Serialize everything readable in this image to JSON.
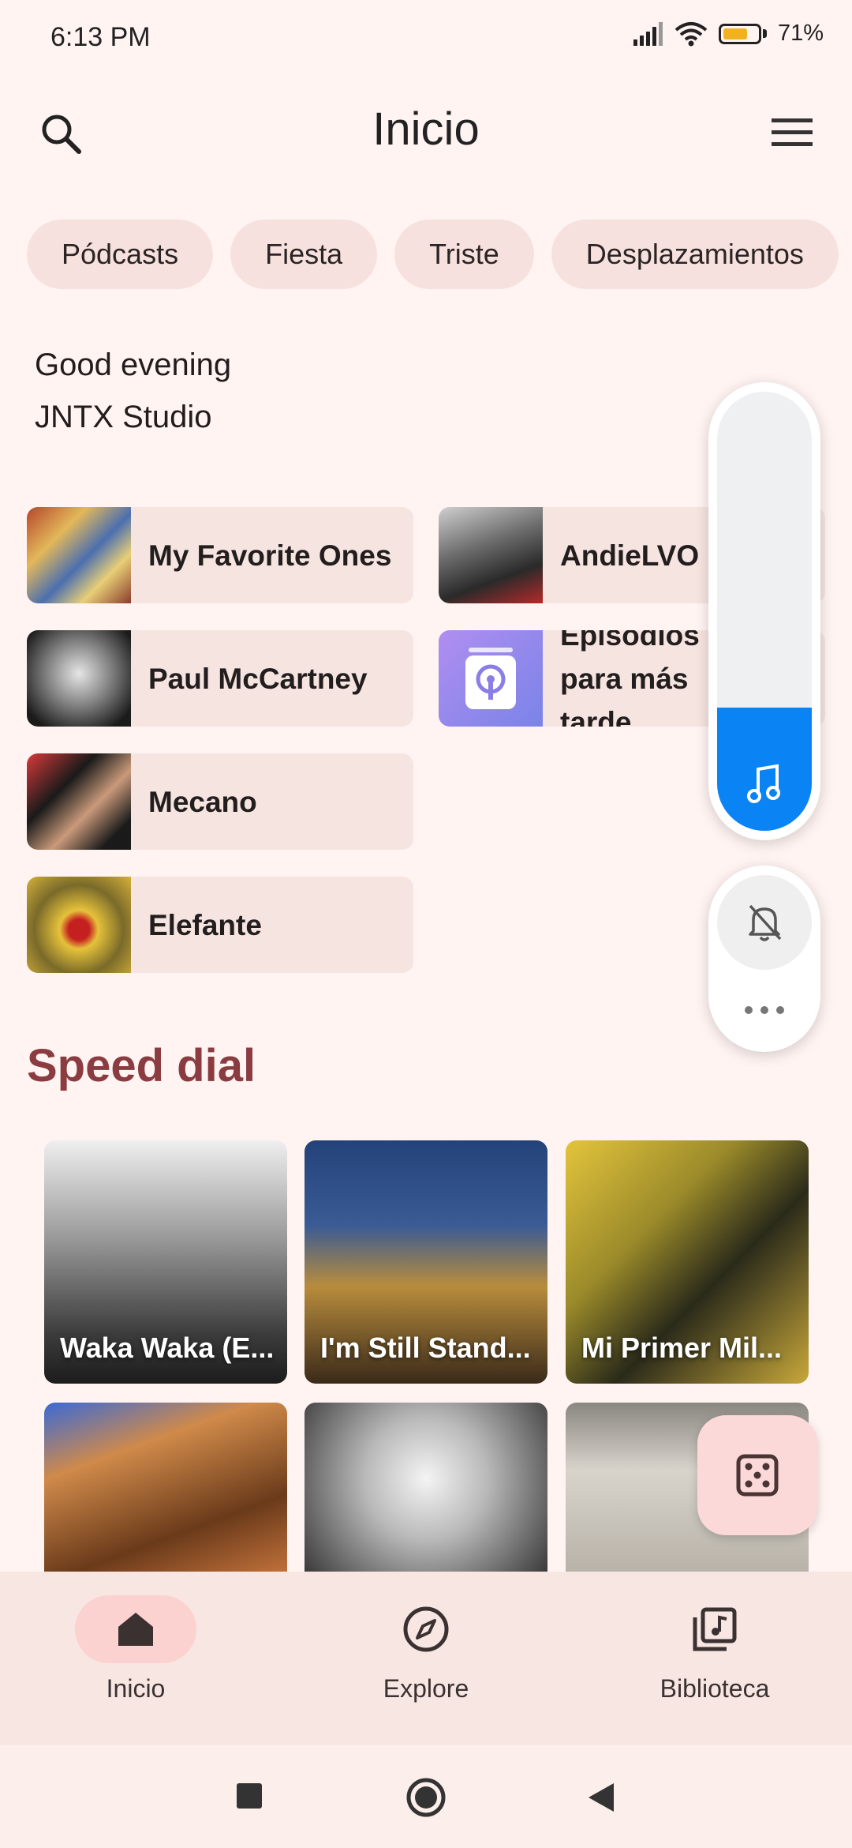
{
  "status_bar": {
    "time": "6:13 PM",
    "battery": "71%"
  },
  "header": {
    "title": "Inicio"
  },
  "chips": [
    "Pódcasts",
    "Fiesta",
    "Triste",
    "Desplazamientos"
  ],
  "greeting": {
    "line1": "Good evening",
    "line2": "JNTX Studio"
  },
  "quick_picks": [
    {
      "label": "My Favorite Ones"
    },
    {
      "label": "AndieLVO"
    },
    {
      "label": "Paul McCartney"
    },
    {
      "label": "Episodios para más tarde"
    },
    {
      "label": "Mecano"
    },
    {
      "label": "Elefante"
    }
  ],
  "speed_dial": {
    "title": "Speed dial",
    "cards": [
      {
        "label": "Waka Waka (E..."
      },
      {
        "label": "I'm Still Stand..."
      },
      {
        "label": "Mi Primer Mil..."
      },
      {
        "label": ""
      },
      {
        "label": ""
      },
      {
        "label": ""
      }
    ]
  },
  "bottom_nav": [
    {
      "label": "Inicio",
      "icon": "home-icon",
      "active": true
    },
    {
      "label": "Explore",
      "icon": "compass-icon",
      "active": false
    },
    {
      "label": "Biblioteca",
      "icon": "library-icon",
      "active": false
    }
  ],
  "volume": {
    "level": 0.28,
    "accent": "#0a84f5"
  },
  "colors": {
    "background": "#fff4f2",
    "chip": "#f7e1de",
    "section_title": "#8a3c41",
    "fab": "#fbd9d8"
  }
}
